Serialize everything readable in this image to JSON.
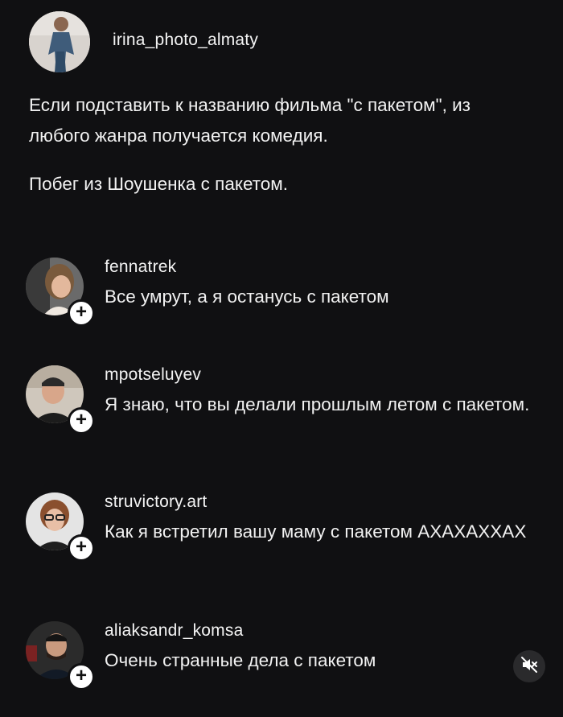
{
  "post": {
    "username": "irina_photo_almaty",
    "caption": [
      "Если подставить к названию фильма \"с пакетом\", из любого жанра получается комедия.",
      "Побег из Шоушенка с пакетом."
    ]
  },
  "comments": [
    {
      "username": "fennatrek",
      "text": "Все умрут, а я останусь с пакетом"
    },
    {
      "username": "mpotseluyev",
      "text": "Я знаю, что вы делали прошлым летом с пакетом."
    },
    {
      "username": "struvictory.art",
      "text": "Как я встретил вашу маму с пакетом АХАХАХХАХ"
    },
    {
      "username": "aliaksandr_komsa",
      "text": "Очень странные дела с пакетом"
    }
  ],
  "ui": {
    "follow_symbol": "+"
  },
  "icons": {
    "mute": "speaker-muted-icon"
  },
  "colors": {
    "background": "#101012",
    "text": "#f2f2f2",
    "follow_badge": "#ffffff"
  }
}
